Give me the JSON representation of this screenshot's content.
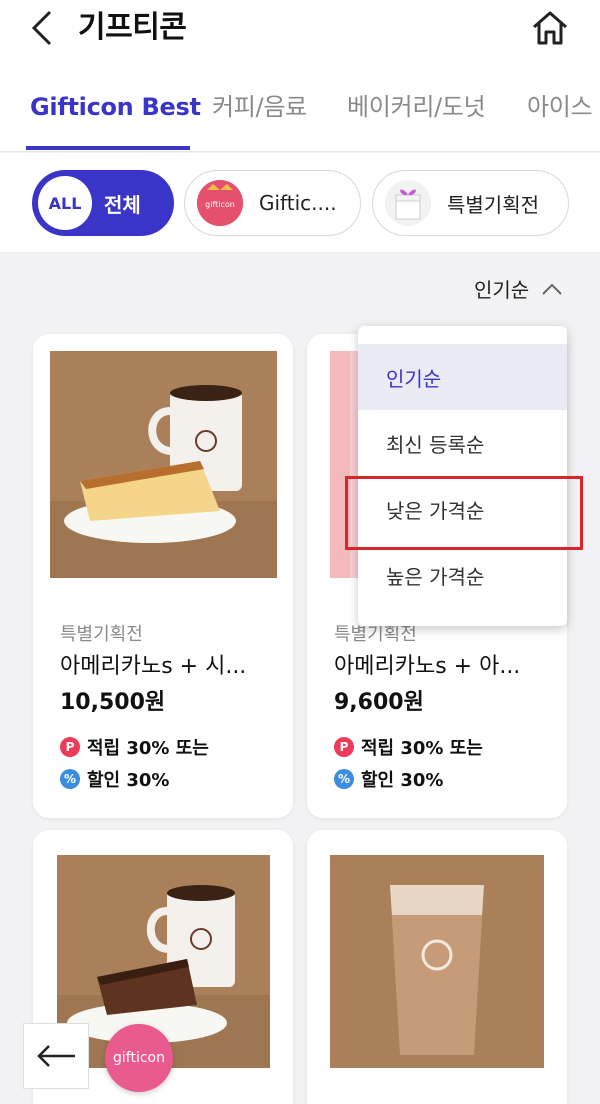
{
  "header": {
    "title": "기프티콘",
    "back_icon": "chevron-left-icon",
    "home_icon": "home-icon"
  },
  "tabs": [
    {
      "label": "Gifticon Best",
      "active": true
    },
    {
      "label": "커피/음료",
      "active": false
    },
    {
      "label": "베이커리/도넛",
      "active": false
    },
    {
      "label": "아이스",
      "active": false
    }
  ],
  "chips": {
    "all_badge": "ALL",
    "all_label": "전체",
    "gifticon_label": "Giftic....",
    "gifticon_thumb_text": "gifticon",
    "special_label": "특별기획전"
  },
  "sort": {
    "current": "인기순",
    "options": [
      "인기순",
      "최신 등록순",
      "낮은 가격순",
      "높은 가격순"
    ],
    "highlighted_option": "낮은 가격순"
  },
  "products": [
    {
      "category": "특별기획전",
      "name": "아메리카노s + 시...",
      "price": "10,500원",
      "point_benefit": "적립 30% 또는",
      "discount_benefit": "할인 30%"
    },
    {
      "category": "특별기획전",
      "name": "아메리카노s + 아...",
      "price": "9,600원",
      "point_benefit": "적립 30% 또는",
      "discount_benefit": "할인 30%"
    }
  ],
  "benefit_icons": {
    "point": "P",
    "discount": "%"
  },
  "floating": {
    "back_icon": "arrow-left-icon",
    "gifticon_button": "gifticon"
  },
  "colors": {
    "accent": "#3b34c8",
    "highlight_box": "#d9252e",
    "point": "#ee3b5a",
    "discount": "#3b8de0"
  }
}
